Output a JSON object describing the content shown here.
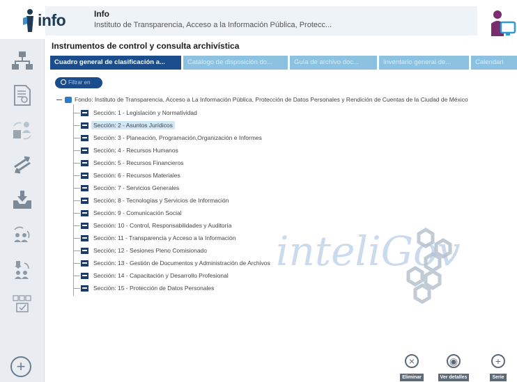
{
  "header": {
    "logo_text": "info",
    "title": "Info",
    "subtitle": "Instituto de Transparencia, Acceso a la Información Pública, Protecc..."
  },
  "panel": {
    "title": "Instrumentos de control y consulta archivística",
    "tabs": [
      {
        "label": "Cuadro general de clasificación a...",
        "active": true
      },
      {
        "label": "Catálogo de disposición do...",
        "active": false
      },
      {
        "label": "Guía de archivo doc...",
        "active": false
      },
      {
        "label": "Inventario general de...",
        "active": false
      },
      {
        "label": "Calendari",
        "active": false
      }
    ],
    "filter_label": "Filtrar en"
  },
  "tree": {
    "root": "Fondo: Instituto de Transparencia, Acceso a La Información Pública, Protección de Datos Personales y Rendición de Cuentas de la Ciudad de México",
    "sections": [
      {
        "label": "Sección: 1 - Legislación y Normatividad",
        "selected": false
      },
      {
        "label": "Sección: 2 - Asuntos Jurídicos",
        "selected": true
      },
      {
        "label": "Sección: 3 - Planeación, Programación,Organización e Informes",
        "selected": false
      },
      {
        "label": "Sección: 4 - Recursos Humanos",
        "selected": false
      },
      {
        "label": "Sección: 5 - Recursos Financieros",
        "selected": false
      },
      {
        "label": "Sección: 6 - Recursos Materiales",
        "selected": false
      },
      {
        "label": "Sección: 7 - Servicios Generales",
        "selected": false
      },
      {
        "label": "Sección: 8 - Tecnologías y Servicios de Información",
        "selected": false
      },
      {
        "label": "Sección: 9 - Comunicación Social",
        "selected": false
      },
      {
        "label": "Sección: 10 - Control, Responsabilidades y Auditoría",
        "selected": false
      },
      {
        "label": "Sección: 11 - Transparencia y Acceso a la Información",
        "selected": false
      },
      {
        "label": "Sección: 12 - Sesiones Pleno Comisionado",
        "selected": false
      },
      {
        "label": "Sección: 13 - Gestión de Documentos y Administración de Archivos",
        "selected": false
      },
      {
        "label": "Sección: 14 - Capacitación y Desarrollo Profesional",
        "selected": false
      },
      {
        "label": "Sección: 15 - Protección de Datos Personales",
        "selected": false
      }
    ]
  },
  "watermark": {
    "text": "inteliGov"
  },
  "actions": {
    "eliminar": "Eliminar",
    "ver_detalles": "Ver detalles",
    "serie": "Serie"
  },
  "colors": {
    "primary": "#1b4c8c",
    "tab_inactive": "#8cc2e0",
    "selected_row": "#cfe7f7",
    "sidebar": "#e9edf1"
  }
}
